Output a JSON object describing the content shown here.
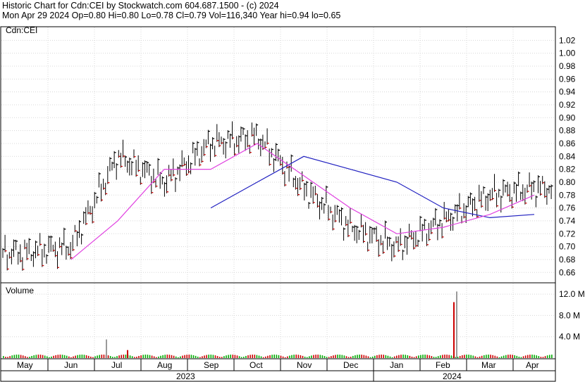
{
  "header": {
    "line1": "Historic Chart for Cdn:CEI by Stockwatch.com 604.687.1500 - (c) 2024",
    "line2": "Mon Apr 29 2024  Op=0.80  Hi=0.80  Lo=0.78  Cl=0.79  Vol=116,340  Year hi=0.94  lo=0.65"
  },
  "colors": {
    "background": "#ffffff",
    "grid": "#d8d8d8",
    "up_tick": "#000000",
    "down_tick": "#cc0000",
    "ma_short": "#e040e0",
    "ma_long": "#2020c0",
    "volume_up": "#00aa00",
    "volume_down": "#cc0000"
  },
  "chart_data": [
    {
      "type": "ohlc",
      "symbol_label": "Cdn:CEI",
      "price_ticks": [
        "1.02",
        "1.00",
        "0.98",
        "0.96",
        "0.94",
        "0.92",
        "0.90",
        "0.88",
        "0.86",
        "0.84",
        "0.82",
        "0.80",
        "0.78",
        "0.76",
        "0.74",
        "0.72",
        "0.70",
        "0.68",
        "0.66"
      ],
      "ylim": [
        0.645,
        1.04
      ],
      "grid": true,
      "x_month_labels": [
        "May",
        "Jun",
        "Jul",
        "Aug",
        "Sep",
        "Oct",
        "Nov",
        "Dec",
        "Jan",
        "Feb",
        "Mar",
        "Apr"
      ],
      "x_year_labels": [
        "2023",
        "2024"
      ],
      "series": [
        {
          "name": "",
          "values": [
            {
              "date": "2023-05",
              "price": 0.69
            },
            {
              "date": "2023-06",
              "price": 0.7
            },
            {
              "date": "2023-07",
              "price": 0.84
            },
            {
              "date": "2023-08",
              "price": 0.8
            },
            {
              "date": "2023-09",
              "price": 0.86
            },
            {
              "date": "2023-10",
              "price": 0.87
            },
            {
              "date": "2023-11",
              "price": 0.79
            },
            {
              "date": "2023-12",
              "price": 0.73
            },
            {
              "date": "2024-01",
              "price": 0.7
            },
            {
              "date": "2024-02",
              "price": 0.74
            },
            {
              "date": "2024-03",
              "price": 0.78
            },
            {
              "date": "2024-04",
              "price": 0.79
            }
          ]
        },
        {
          "name": "",
          "note_ma": "short moving average",
          "values": [
            {
              "date": "2023-06",
              "price": 0.68
            },
            {
              "date": "2023-07",
              "price": 0.74
            },
            {
              "date": "2023-08",
              "price": 0.82
            },
            {
              "date": "2023-09",
              "price": 0.82
            },
            {
              "date": "2023-10",
              "price": 0.86
            },
            {
              "date": "2023-11",
              "price": 0.81
            },
            {
              "date": "2023-12",
              "price": 0.76
            },
            {
              "date": "2024-01",
              "price": 0.72
            },
            {
              "date": "2024-02",
              "price": 0.73
            },
            {
              "date": "2024-03",
              "price": 0.75
            },
            {
              "date": "2024-04",
              "price": 0.78
            }
          ]
        },
        {
          "name": "",
          "note_ma": "long moving average",
          "values": [
            {
              "date": "2023-09",
              "price": 0.76
            },
            {
              "date": "2023-10",
              "price": 0.8
            },
            {
              "date": "2023-11",
              "price": 0.84
            },
            {
              "date": "2023-12",
              "price": 0.82
            },
            {
              "date": "2024-01",
              "price": 0.8
            },
            {
              "date": "2024-02",
              "price": 0.76
            },
            {
              "date": "2024-03",
              "price": 0.745
            },
            {
              "date": "2024-04",
              "price": 0.75
            }
          ]
        }
      ]
    },
    {
      "type": "bar",
      "title": "Volume",
      "volume_ticks": [
        "12.0 M",
        "8.0 M",
        "4.0 M"
      ],
      "ylim": [
        0,
        14
      ],
      "unit": "M",
      "notable": [
        {
          "date": "2023-07",
          "value": 3.5
        },
        {
          "date": "2023-07",
          "value": 1.5
        },
        {
          "date": "2024-02",
          "value": 10.5
        },
        {
          "date": "2024-02",
          "value": 12.5
        }
      ]
    }
  ]
}
